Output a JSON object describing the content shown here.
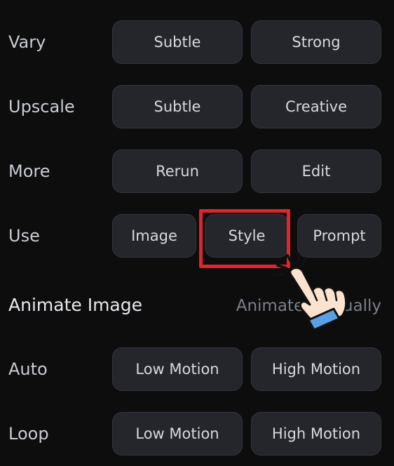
{
  "rows": {
    "vary": {
      "label": "Vary",
      "buttons": [
        "Subtle",
        "Strong"
      ]
    },
    "upscale": {
      "label": "Upscale",
      "buttons": [
        "Subtle",
        "Creative"
      ]
    },
    "more": {
      "label": "More",
      "buttons": [
        "Rerun",
        "Edit"
      ]
    },
    "use": {
      "label": "Use",
      "buttons": [
        "Image",
        "Style",
        "Prompt"
      ]
    }
  },
  "animate": {
    "title": "Animate Image",
    "link": "Animate Manually",
    "auto": {
      "label": "Auto",
      "buttons": [
        "Low Motion",
        "High Motion"
      ]
    },
    "loop": {
      "label": "Loop",
      "buttons": [
        "Low Motion",
        "High Motion"
      ]
    }
  },
  "annotation": {
    "highlight_color": "#e0262a",
    "pointer_icon": "pointing-hand-icon"
  }
}
